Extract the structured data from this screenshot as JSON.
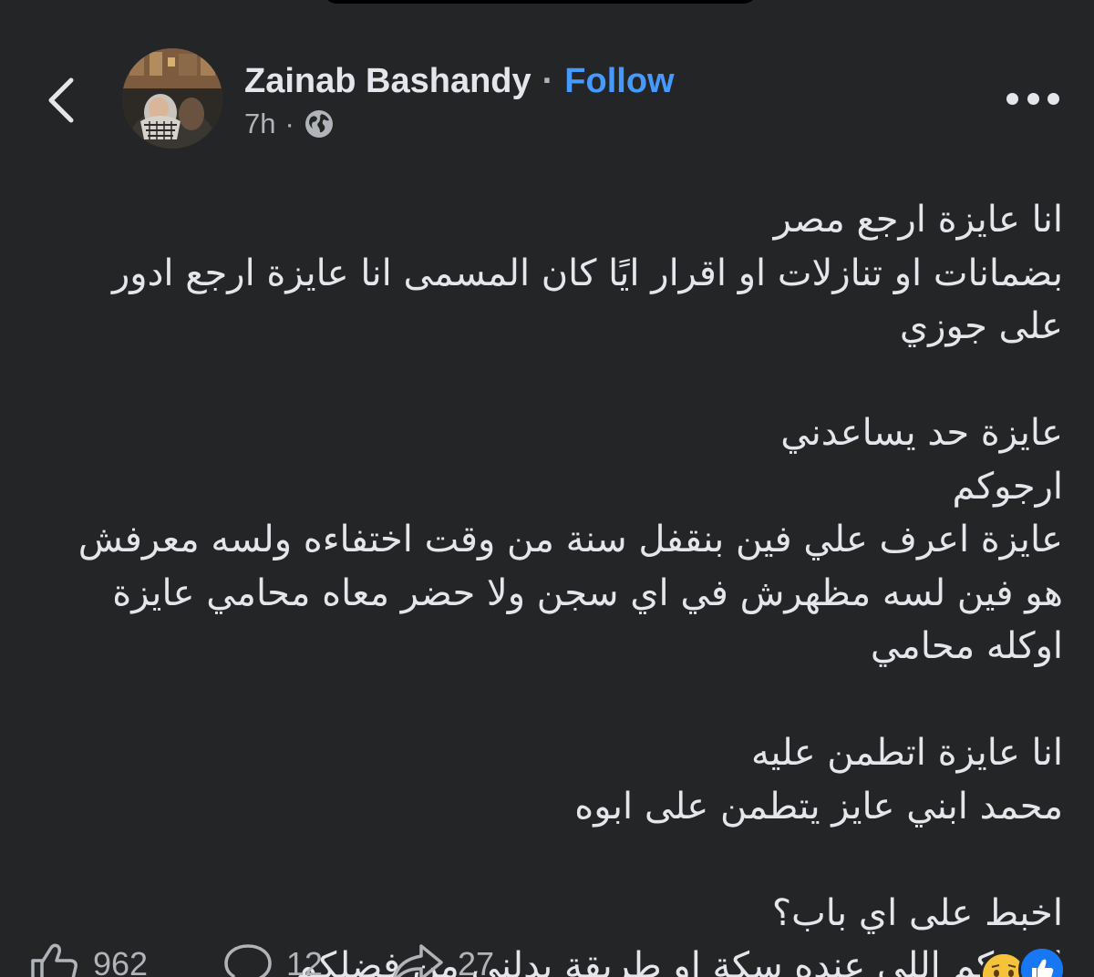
{
  "post": {
    "author": "Zainab Bashandy",
    "separator": "·",
    "follow_label": "Follow",
    "time": "7h",
    "meta_separator": "·",
    "audience_icon": "globe-icon",
    "paragraphs": [
      [
        "انا عايزة ارجع مصر",
        "بضمانات او تنازلات او اقرار ايًا كان المسمى انا عايزة ارجع ادور على جوزي"
      ],
      [
        "عايزة حد يساعدني",
        "ارجوكم",
        "عايزة اعرف علي فين بنقفل سنة من وقت اختفاءه ولسه معرفش هو فين لسه مظهرش في اي سجن ولا حضر معاه محامي عايزة اوكله محامي"
      ],
      [
        "انا عايزة اتطمن عليه",
        "محمد ابني عايز يتطمن على ابوه"
      ],
      [
        "اخبط على اي باب؟",
        "ارجوكم اللي عنده سكة او طريقة يدلني من فضلكم"
      ]
    ]
  },
  "footer": {
    "likes": "962",
    "comments": "12",
    "shares": "27",
    "reaction_icons": [
      "sad-face-icon",
      "like-badge-icon"
    ]
  },
  "colors": {
    "background": "#242526",
    "text": "#e4e6eb",
    "secondary_text": "#b0b3b8",
    "link": "#4599ff"
  }
}
